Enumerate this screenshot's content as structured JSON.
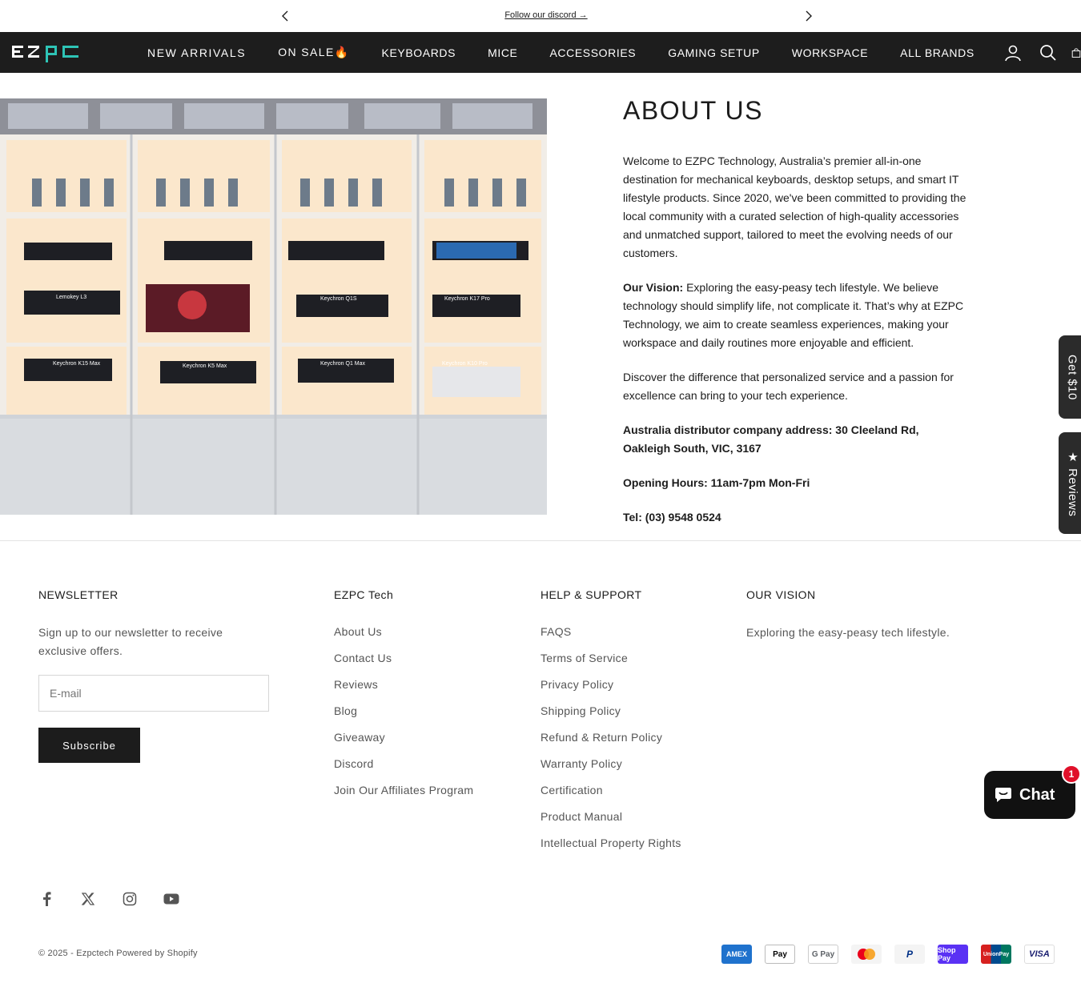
{
  "announcement": {
    "message": "Follow our discord →"
  },
  "header": {
    "logo_text": "EZPC",
    "nav": [
      "NEW ARRIVALS",
      "ON SALE🔥",
      "KEYBOARDS",
      "MICE",
      "ACCESSORIES",
      "GAMING SETUP",
      "WORKSPACE",
      "ALL BRANDS"
    ]
  },
  "about": {
    "title": "ABOUT US",
    "intro": "Welcome to EZPC Technology, Australia’s premier all-in-one destination for mechanical keyboards, desktop setups, and smart IT lifestyle products. Since 2020, we've been committed to providing the local community with a curated selection of high-quality accessories and unmatched support, tailored to meet the evolving needs of our customers.",
    "vision_label": "Our Vision:",
    "vision_text": " Exploring the easy-peasy tech lifestyle. We believe technology should simplify life, not complicate it. That’s why at EZPC Technology, we aim to create seamless experiences, making your workspace and daily routines more enjoyable and efficient.",
    "discover": "Discover the difference that personalized service and a passion for excellence can bring to your tech experience.",
    "address": "Australia distributor company address: 30 Cleeland Rd, Oakleigh South, VIC, 3167",
    "hours": "Opening Hours: 11am-7pm Mon-Fri",
    "tel": "Tel: (03) 9548 0524",
    "image_labels": [
      "Lemokey L3",
      "Keychron Q1S",
      "Keychron K17 Pro",
      "Keychron K15 Max",
      "Keychron K5 Max",
      "Keychron Q1 Max",
      "Keychron K10 Pro"
    ]
  },
  "side_tabs": {
    "tab1": "Get $10",
    "tab2": "★ Reviews"
  },
  "footer": {
    "newsletter": {
      "heading": "NEWSLETTER",
      "text": "Sign up to our newsletter to receive exclusive offers.",
      "email_placeholder": "E-mail",
      "button": "Subscribe"
    },
    "ezpc": {
      "heading": "EZPC Tech",
      "links": [
        "About Us",
        "Contact Us",
        "Reviews",
        "Blog",
        "Giveaway",
        "Discord",
        "Join Our Affiliates Program"
      ]
    },
    "help": {
      "heading": "HELP & SUPPORT",
      "links": [
        "FAQS",
        "Terms of Service",
        "Privacy Policy",
        "Shipping Policy",
        "Refund & Return Policy",
        "Warranty Policy",
        "Certification",
        "Product Manual",
        "Intellectual Property Rights"
      ]
    },
    "vision": {
      "heading": "OUR VISION",
      "text": "Exploring the easy-peasy tech lifestyle."
    },
    "copyright": "© 2025 - Ezpctech Powered by Shopify",
    "payments": [
      "AMEX",
      "Pay",
      "G Pay",
      "",
      "P",
      "Shop Pay",
      "UnionPay",
      "VISA"
    ]
  },
  "chat": {
    "label": "Chat",
    "badge": "1"
  },
  "colors": {
    "header_bg": "#1d1d1d",
    "accent": "#2ec4b6",
    "chat_badge": "#e0102a"
  }
}
